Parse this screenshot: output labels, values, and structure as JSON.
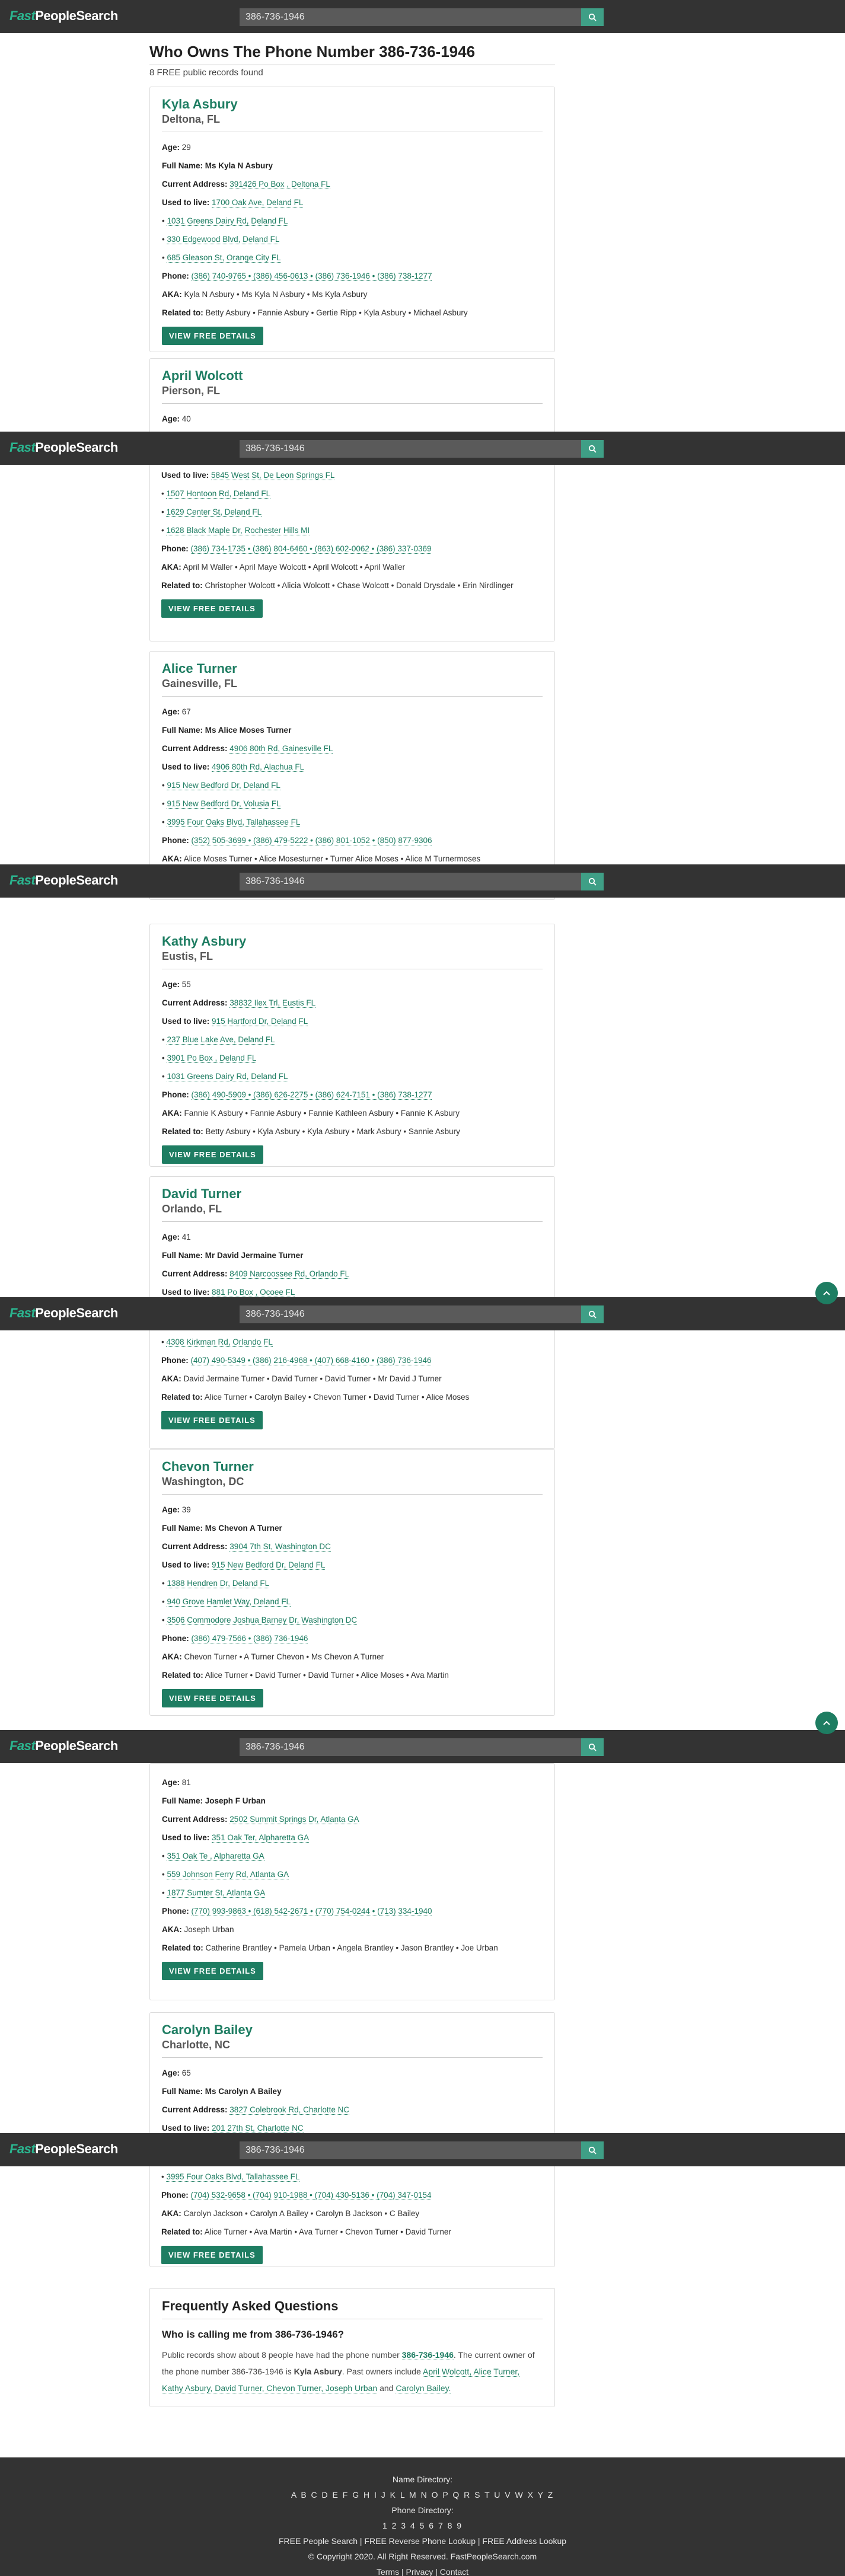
{
  "brand": {
    "part1": "Fast",
    "part2": "PeopleSearch"
  },
  "search": {
    "value": "386-736-1946"
  },
  "page": {
    "title": "Who Owns The Phone Number 386-736-1946",
    "count": "8 FREE public records found"
  },
  "labels": {
    "age": "Age:",
    "full_name": "Full Name:",
    "current_address": "Current Address:",
    "used_to_live": "Used to live:",
    "phone": "Phone:",
    "aka": "AKA:",
    "related": "Related to:",
    "button": "VIEW FREE DETAILS"
  },
  "records": [
    {
      "name": "Kyla Asbury",
      "location": "Deltona, FL",
      "age": "29",
      "full_name": "Ms Kyla N Asbury",
      "current_address": "391426 Po Box , Deltona FL",
      "used_to_live": "1700 Oak Ave, Deland FL",
      "prev": [
        "1031 Greens Dairy Rd, Deland FL",
        "330 Edgewood Blvd, Deland FL",
        "685 Gleason St, Orange City FL"
      ],
      "phones": "(386) 740-9765 • (386) 456-0613 • (386) 736-1946 • (386) 738-1277",
      "aka": "Kyla N Asbury • Ms Kyla N Asbury • Ms Kyla Asbury",
      "related": "Betty Asbury • Fannie Asbury • Gertie Ripp • Kyla Asbury • Michael Asbury"
    },
    {
      "name": "April Wolcott",
      "location": "Pierson, FL",
      "age": "40",
      "used_to_live": "5845 West St, De Leon Springs FL",
      "prev": [
        "1507 Hontoon Rd, Deland FL",
        "1629 Center St, Deland FL",
        "1628 Black Maple Dr, Rochester Hills MI"
      ],
      "phones": "(386) 734-1735 • (386) 804-6460 • (863) 602-0062 • (386) 337-0369",
      "aka": "April M Waller • April Maye Wolcott • April Wolcott • April Waller",
      "related": "Christopher Wolcott • Alicia Wolcott • Chase Wolcott • Donald Drysdale • Erin Nirdlinger"
    },
    {
      "name": "Alice Turner",
      "location": "Gainesville, FL",
      "age": "67",
      "full_name": "Ms Alice Moses Turner",
      "current_address": "4906 80th Rd, Gainesville FL",
      "used_to_live": "4906 80th Rd, Alachua FL",
      "prev": [
        "915 New Bedford Dr, Deland FL",
        "915 New Bedford Dr, Volusia FL",
        "3995 Four Oaks Blvd, Tallahassee FL"
      ],
      "phones": "(352) 505-3699 • (386) 479-5222 • (386) 801-1052 • (850) 877-9306",
      "aka": "Alice Moses Turner • Alice Mosesturner • Turner Alice Moses • Alice M Turnermoses"
    },
    {
      "name": "Kathy Asbury",
      "location": "Eustis, FL",
      "age": "55",
      "current_address": "38832 Ilex Trl, Eustis FL",
      "used_to_live": "915 Hartford Dr, Deland FL",
      "prev": [
        "237 Blue Lake Ave, Deland FL",
        "3901 Po Box , Deland FL",
        "1031 Greens Dairy Rd, Deland FL"
      ],
      "phones": "(386) 490-5909 • (386) 626-2275 • (386) 624-7151 • (386) 738-1277",
      "aka": "Fannie K Asbury • Fannie Asbury • Fannie Kathleen Asbury • Fannie K Asbury",
      "related": "Betty Asbury • Kyla Asbury • Kyla Asbury • Mark Asbury • Sannie Asbury"
    },
    {
      "name": "David Turner",
      "location": "Orlando, FL",
      "age": "41",
      "full_name": "Mr David Jermaine Turner",
      "current_address": "8409 Narcoossee Rd, Orlando FL",
      "used_to_live": "881 Po Box , Ocoee FL",
      "prev": [
        "4308 Kirkman Rd, Orlando FL"
      ],
      "phones": "(407) 490-5349 • (386) 216-4968 • (407) 668-4160 • (386) 736-1946",
      "aka": "David Jermaine Turner • David Turner • David Turner • Mr David J Turner",
      "related": "Alice Turner • Carolyn Bailey • Chevon Turner • David Turner • Alice Moses"
    },
    {
      "name": "Chevon Turner",
      "location": "Washington, DC",
      "age": "39",
      "full_name": "Ms Chevon A Turner",
      "current_address": "3904 7th St, Washington DC",
      "used_to_live": "915 New Bedford Dr, Deland FL",
      "prev": [
        "1388 Hendren Dr, Deland FL",
        "940 Grove Hamlet Way, Deland FL",
        "3506 Commodore Joshua Barney Dr, Washington DC"
      ],
      "phones": "(386) 479-7566 • (386) 736-1946",
      "aka": "Chevon Turner • A Turner Chevon • Ms Chevon A Turner",
      "related": "Alice Turner • David Turner • David Turner • Alice Moses • Ava Martin"
    },
    {
      "name": "Joseph Urban",
      "age": "81",
      "full_name": "Joseph F Urban",
      "current_address": "2502 Summit Springs Dr, Atlanta GA",
      "used_to_live": "351 Oak Ter, Alpharetta GA",
      "prev": [
        "351 Oak Te , Alpharetta GA",
        "559 Johnson Ferry Rd, Atlanta GA",
        "1877 Sumter St, Atlanta GA"
      ],
      "phones": "(770) 993-9863 • (618) 542-2671 • (770) 754-0244 • (713) 334-1940",
      "aka": "Joseph Urban",
      "related": "Catherine Brantley • Pamela Urban • Angela Brantley • Jason Brantley • Joe Urban"
    },
    {
      "name": "Carolyn Bailey",
      "location": "Charlotte, NC",
      "age": "65",
      "full_name": "Ms Carolyn A Bailey",
      "current_address": "3827 Colebrook Rd, Charlotte NC",
      "used_to_live": "201 27th St, Charlotte NC",
      "prev": [
        "3995 Four Oaks Blvd, Tallahassee FL"
      ],
      "phones": "(704) 532-9658 • (704) 910-1988 • (704) 430-5136 • (704) 347-0154",
      "aka": "Carolyn Jackson • Carolyn A Bailey • Carolyn B Jackson • C Bailey",
      "related": "Alice Turner • Ava Martin • Ava Turner • Chevon Turner • David Turner"
    }
  ],
  "faq": {
    "title": "Frequently Asked Questions",
    "q1": "Who is calling me from 386-736-1946?",
    "a1_text1": "Public records show about 8 people have had the phone number",
    "a1_phone": "386-736-1946",
    "a1_text2": ". The current owner of the phone number 386-736-1946 is",
    "a1_owner": "Kyla Asbury",
    "a1_text3": ". Past owners include",
    "a1_past": "April Wolcott, Alice Turner, Kathy Asbury, David Turner, Chevon Turner, Joseph Urban",
    "a1_and": "and",
    "a1_last": "Carolyn Bailey."
  },
  "footer": {
    "name_dir": "Name Directory:",
    "letters": "A B C D E F G H I J K L M N O P Q R S T U V W X Y Z",
    "phone_dir": "Phone Directory:",
    "digits": "1 2 3 4 5 6 7 8 9",
    "links": "FREE People Search | FREE Reverse Phone Lookup | FREE Address Lookup",
    "copyright": "© Copyright 2020. All Right Reserved. FastPeopleSearch.com",
    "legal": "Terms | Privacy | Contact"
  }
}
